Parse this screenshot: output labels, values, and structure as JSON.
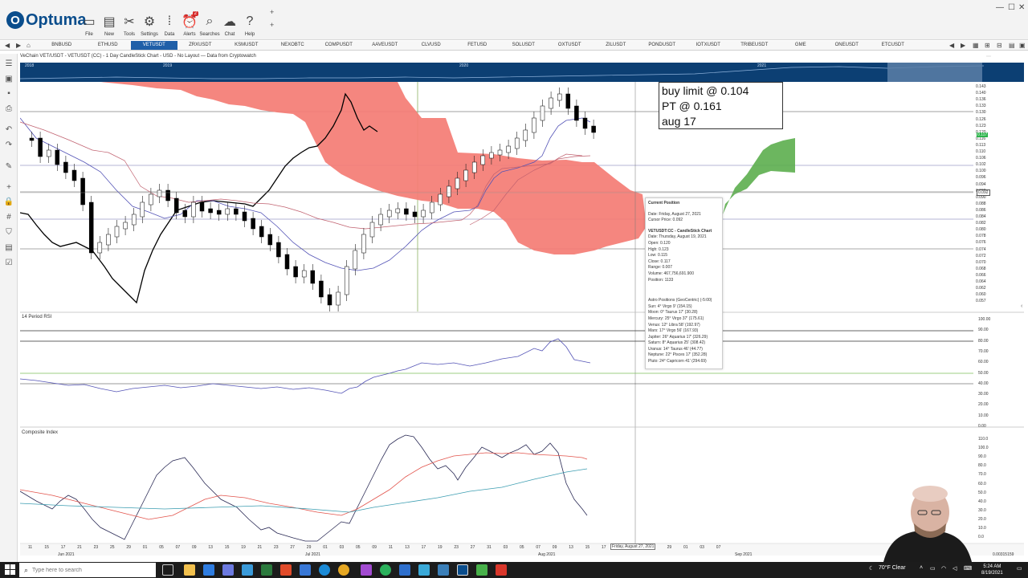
{
  "app": {
    "logo_text": "Optuma",
    "toolbar": [
      {
        "label": "File",
        "icon": "folder-icon"
      },
      {
        "label": "New",
        "icon": "new-document-icon"
      },
      {
        "label": "Tools",
        "icon": "tools-icon"
      },
      {
        "label": "Settings",
        "icon": "gear-icon"
      },
      {
        "label": "Data",
        "icon": "binary-data-icon"
      },
      {
        "label": "Alerts",
        "icon": "alarm-clock-icon",
        "badge": "2"
      },
      {
        "label": "Searches",
        "icon": "search-icon"
      },
      {
        "label": "Chat",
        "icon": "chat-icon"
      },
      {
        "label": "Help",
        "icon": "help-icon"
      }
    ]
  },
  "tabs": [
    "BNBUSD",
    "ETHUSD",
    "VETUSDT",
    "ZRXUSDT",
    "KSMUSDT",
    "NEXOBTC",
    "COMPUSDT",
    "AAVEUSDT",
    "CLVUSD",
    "FETUSD",
    "SOLUSDT",
    "OXTUSDT",
    "ZILUSDT",
    "PONDUSDT",
    "IOTXUSDT",
    "TRIBEUSDT",
    "GME",
    "ONEUSDT",
    "ETCUSDT"
  ],
  "active_tab": "VETUSDT",
  "chart_header": "VeChain VET/USDT - VETUSDT (CC) - 1 Day CandleStick Chart - USD - No Layout — Data from Cryptowatch",
  "overview_years": [
    "2018",
    "2019",
    "2020",
    "2021"
  ],
  "note": {
    "line1": "buy limit @ 0.104",
    "line2": "PT @ 0.161",
    "line3": "aug 17"
  },
  "tooltip": {
    "title": "Current Position",
    "date": "Date: Friday, August 27, 2021",
    "cursor_price": "Cursor Price: 0.092",
    "chart_title": "VETUSDT:CC - CandleStick Chart",
    "bar_date": "Date: Thursday, August 19, 2021",
    "open": "Open: 0.120",
    "high": "High: 0.123",
    "low": "Low: 0.115",
    "close": "Close: 0.117",
    "range": "Range: 0.007",
    "volume": "Volume: 467,756,691.900",
    "position": "Position: 1133",
    "astro_title": "Astro Positions (GeoCentric) (-5:00)",
    "astro": [
      "Sun: 4° Virgo 9' (154.15)",
      "Moon: 0° Taurus 17' (30.28)",
      "Mercury: 25° Virgo 37' (175.61)",
      "Venus: 12° Libra 58' (192.97)",
      "Mars: 17° Virgo 56' (167.93)",
      "Jupiter: 26° Aquarius 17' (326.29)",
      "Saturn: 8° Aquarius 25' (308.42)",
      "Uranus: 14° Taurus 46' (44.77)",
      "Neptune: 22° Pisces 17' (352.28)",
      "Pluto: 24° Capricorn 41' (294.69)"
    ]
  },
  "panes": {
    "rsi_label": "14 Period RSI",
    "composite_label": "Composite Index",
    "price_ticks": [
      "0.143",
      "0.140",
      "0.136",
      "0.133",
      "0.130",
      "0.126",
      "0.123",
      "0.120",
      "0.116",
      "0.113",
      "0.110",
      "0.106",
      "0.102",
      "0.100",
      "0.096",
      "0.094",
      "0.092",
      "0.090",
      "0.088",
      "0.086",
      "0.084",
      "0.082",
      "0.080",
      "0.078",
      "0.076",
      "0.074",
      "0.072",
      "0.070",
      "0.068",
      "0.066",
      "0.064",
      "0.062",
      "0.060",
      "0.057"
    ],
    "rsi_ticks": [
      "100.00",
      "90.00",
      "80.00",
      "70.00",
      "60.00",
      "50.00",
      "40.00",
      "30.00",
      "20.00",
      "10.00",
      "0.00"
    ],
    "composite_ticks": [
      "110.0",
      "100.0",
      "90.0",
      "80.0",
      "70.0",
      "60.0",
      "50.0",
      "40.0",
      "30.0",
      "20.0",
      "10.0",
      "0.0"
    ],
    "last_price": "0.117",
    "cursor_price": "0.092"
  },
  "date_axis": {
    "days": [
      "11",
      "15",
      "17",
      "21",
      "23",
      "25",
      "29",
      "01",
      "05",
      "07",
      "09",
      "13",
      "15",
      "19",
      "21",
      "23",
      "27",
      "29",
      "01",
      "03",
      "05",
      "09",
      "11",
      "13",
      "17",
      "19",
      "23",
      "27",
      "31",
      "03",
      "05",
      "07",
      "09",
      "13",
      "15",
      "17",
      "21",
      "23",
      "27",
      "29",
      "01",
      "03",
      "07"
    ],
    "months": [
      "Jun 2021",
      "Jul 2021",
      "Aug 2021",
      "Sep 2021"
    ],
    "cursor_date": "Friday, August 27, 2021",
    "corner_value": "0.00315159"
  },
  "taskbar": {
    "search_placeholder": "Type here to search",
    "weather": "70°F Clear",
    "time": "5:24 AM",
    "date": "8/19/2021"
  },
  "colors": {
    "accent": "#1f5fa8",
    "cloud_bear": "#f47c74",
    "cloud_bull": "#5cae4e",
    "overview": "#0c3f73"
  }
}
